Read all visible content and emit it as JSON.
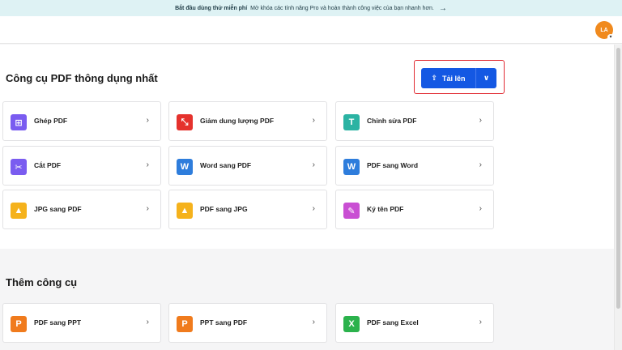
{
  "banner": {
    "bold": "Bắt đầu dùng thử miễn phí",
    "text": "Mở khóa các tính năng Pro và hoàn thành công việc của bạn nhanh hơn.",
    "arrow": "→"
  },
  "user": {
    "initials": "LA",
    "caret": "▾"
  },
  "popular": {
    "title": "Công cụ PDF thông dụng nhất",
    "upload_label": "Tải lên",
    "upload_icon": "⇪",
    "dropdown_icon": "∨",
    "tools": [
      {
        "label": "Ghép PDF",
        "icon": "merge-icon",
        "color": "#7a5cf0",
        "glyph": "⊞"
      },
      {
        "label": "Giảm dung lượng PDF",
        "icon": "compress-icon",
        "color": "#e5322d",
        "glyph": "⤡"
      },
      {
        "label": "Chỉnh sửa PDF",
        "icon": "text-edit-icon",
        "color": "#2bb3a3",
        "glyph": "T"
      },
      {
        "label": "Cắt PDF",
        "icon": "scissors-icon",
        "color": "#7a5cf0",
        "glyph": "✂"
      },
      {
        "label": "Word sang PDF",
        "icon": "word-icon",
        "color": "#2e7ddc",
        "glyph": "W"
      },
      {
        "label": "PDF sang Word",
        "icon": "word-icon",
        "color": "#2e7ddc",
        "glyph": "W"
      },
      {
        "label": "JPG sang PDF",
        "icon": "image-icon",
        "color": "#f5b21c",
        "glyph": "▲"
      },
      {
        "label": "PDF sang JPG",
        "icon": "image-icon",
        "color": "#f5b21c",
        "glyph": "▲"
      },
      {
        "label": "Ký tên PDF",
        "icon": "signature-icon",
        "color": "#c94fd3",
        "glyph": "✎"
      }
    ]
  },
  "more": {
    "title": "Thêm công cụ",
    "tools": [
      {
        "label": "PDF sang PPT",
        "icon": "ppt-icon",
        "color": "#f07b1d",
        "glyph": "P"
      },
      {
        "label": "PPT sang PDF",
        "icon": "ppt-icon",
        "color": "#f07b1d",
        "glyph": "P"
      },
      {
        "label": "PDF sang Excel",
        "icon": "excel-icon",
        "color": "#2bb24c",
        "glyph": "X"
      }
    ]
  },
  "chevron": "›"
}
